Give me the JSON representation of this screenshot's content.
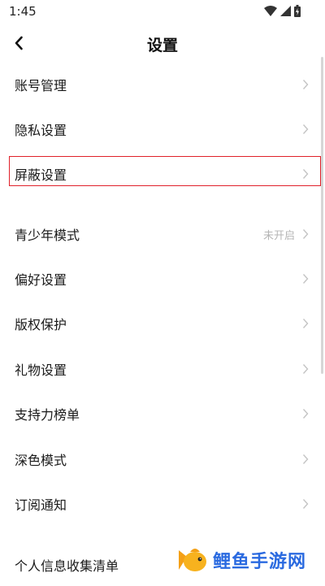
{
  "status_bar": {
    "time": "1:45"
  },
  "nav": {
    "title": "设置"
  },
  "settings": [
    {
      "label": "账号管理",
      "value": ""
    },
    {
      "label": "隐私设置",
      "value": ""
    },
    {
      "label": "屏蔽设置",
      "value": ""
    },
    {
      "label": "青少年模式",
      "value": "未开启"
    },
    {
      "label": "偏好设置",
      "value": ""
    },
    {
      "label": "版权保护",
      "value": ""
    },
    {
      "label": "礼物设置",
      "value": ""
    },
    {
      "label": "支持力榜单",
      "value": ""
    },
    {
      "label": "深色模式",
      "value": ""
    },
    {
      "label": "订阅通知",
      "value": ""
    },
    {
      "label": "个人信息收集清单",
      "value": ""
    }
  ],
  "watermark": {
    "text": "鲤鱼手游网"
  },
  "colors": {
    "highlight": "#e0212a",
    "watermark": "#2a6ae0",
    "chevron": "#c4c4c4"
  }
}
